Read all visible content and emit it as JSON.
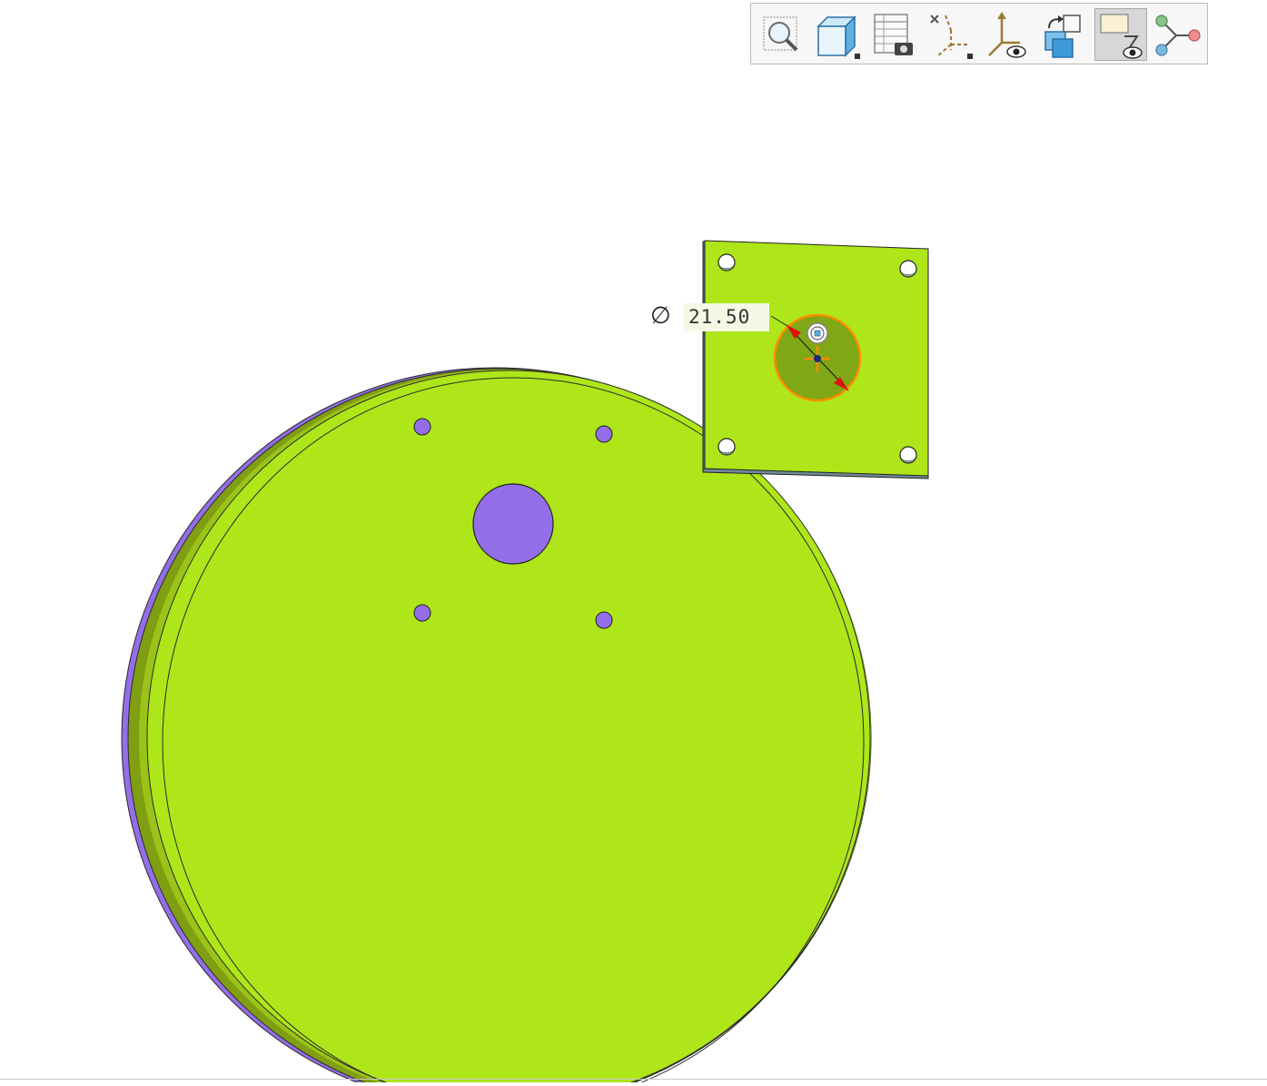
{
  "viewer": {
    "toolbar": {
      "items": [
        {
          "name": "zoom-area",
          "icon": "magnifier-icon"
        },
        {
          "name": "view-orientation",
          "icon": "cube-icon"
        },
        {
          "name": "saved-views",
          "icon": "table-camera-icon"
        },
        {
          "name": "datum-display",
          "icon": "datum-axes-icon"
        },
        {
          "name": "csys-display",
          "icon": "csys-eye-icon"
        },
        {
          "name": "repaint",
          "icon": "copy-arrows-icon"
        },
        {
          "name": "annotation-display",
          "icon": "annotation-eye-icon",
          "active": true
        },
        {
          "name": "spin-center",
          "icon": "node-graph-icon"
        }
      ]
    },
    "dimension": {
      "symbol": "∅",
      "value": "21.50"
    },
    "colors": {
      "part_face": "#aee619",
      "part_side": "#7a9a12",
      "hole": "#946ee8",
      "selection": "#ff8c00",
      "arrow": "#e01010"
    }
  }
}
